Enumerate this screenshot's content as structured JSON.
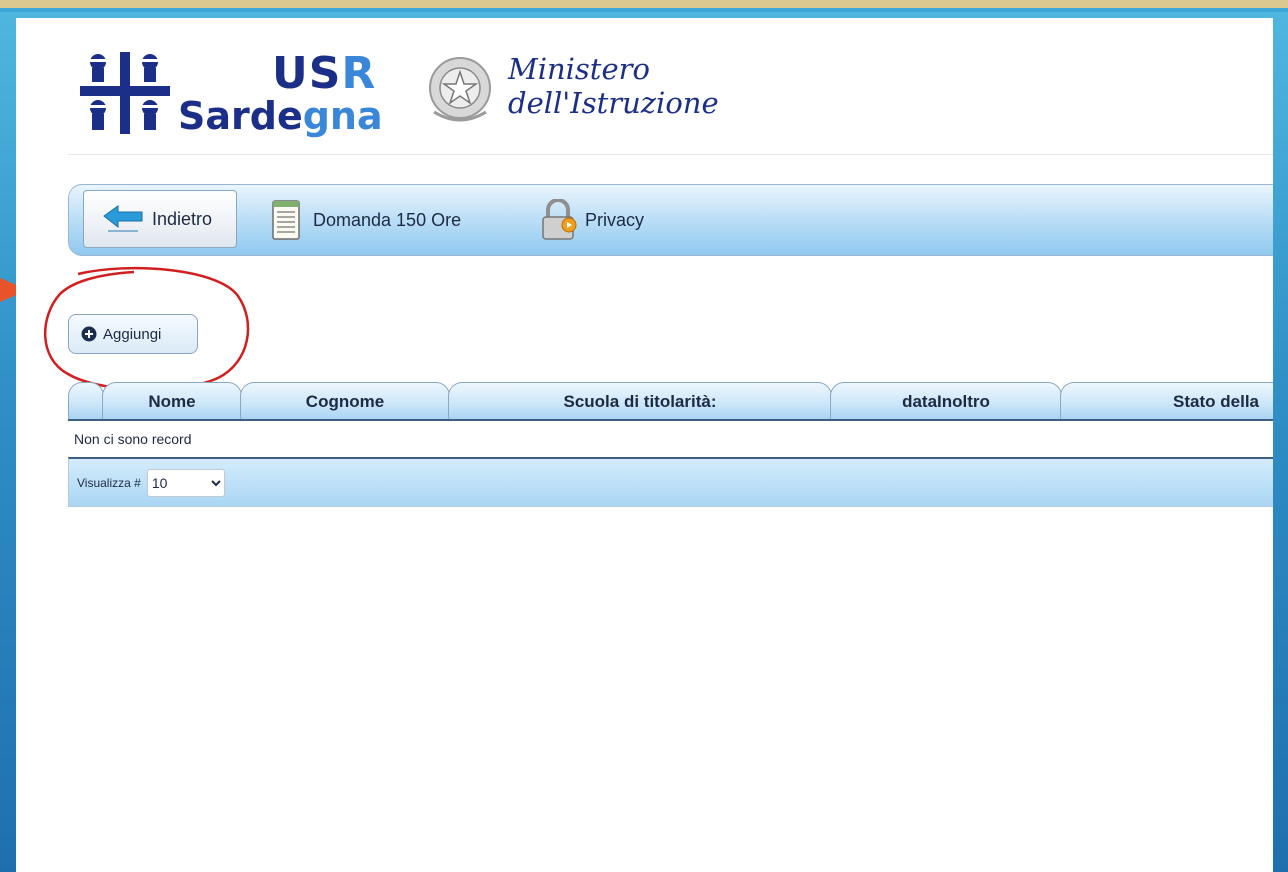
{
  "header": {
    "logo_usr": "USR",
    "logo_sardegna": "Sardegna",
    "ministero_line1": "Ministero",
    "ministero_line2": "dell'Istruzione"
  },
  "toolbar": {
    "back_label": "Indietro",
    "domanda_label": "Domanda 150 Ore",
    "privacy_label": "Privacy"
  },
  "actions": {
    "add_label": "Aggiungi"
  },
  "grid": {
    "columns": [
      "Nome",
      "Cognome",
      "Scuola di titolarità:",
      "dataInoltro",
      "Stato della"
    ],
    "empty_message": "Non ci sono record",
    "pager_label": "Visualizza #",
    "page_size": "10",
    "page_size_options": [
      "10"
    ]
  },
  "colors": {
    "brand_dark": "#1b2e88",
    "brand_light": "#3a86d8",
    "annotation_red": "#d11f1f",
    "arrow_orange": "#e8532a"
  }
}
